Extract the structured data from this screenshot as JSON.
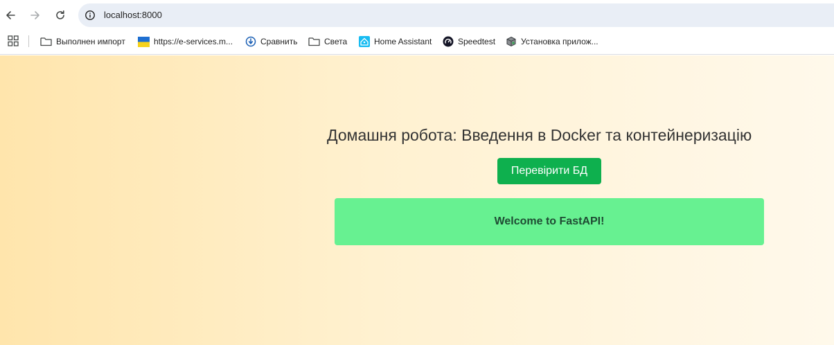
{
  "browser": {
    "url": "localhost:8000"
  },
  "bookmarks": [
    {
      "label": "Выполнен импорт",
      "icon": "folder-icon"
    },
    {
      "label": "https://e-services.m...",
      "icon": "ukraine-flag-icon"
    },
    {
      "label": "Сравнить",
      "icon": "compare-icon"
    },
    {
      "label": "Света",
      "icon": "folder-icon"
    },
    {
      "label": "Home Assistant",
      "icon": "home-assistant-icon"
    },
    {
      "label": "Speedtest",
      "icon": "speedtest-icon"
    },
    {
      "label": "Установка прилож...",
      "icon": "package-icon"
    }
  ],
  "main": {
    "title": "Домашня робота: Введення в Docker та контейнеризацію",
    "check_button_label": "Перевірити БД",
    "result_message": "Welcome to FastAPI!"
  },
  "colors": {
    "button": "#0eb04e",
    "result_box": "#67f191",
    "page_gradient_start": "#ffe5ac",
    "page_gradient_end": "#fff9eb"
  }
}
